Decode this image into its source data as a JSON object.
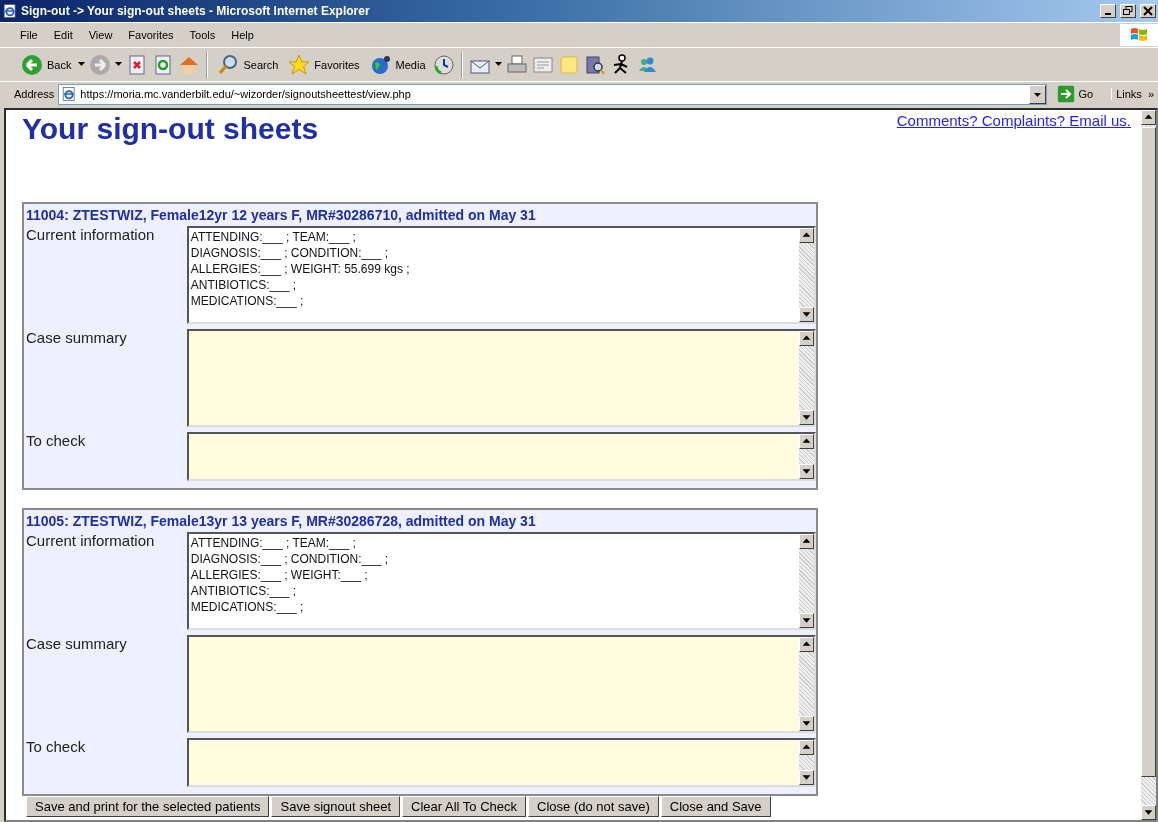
{
  "window": {
    "title": "Sign-out -> Your sign-out sheets - Microsoft Internet Explorer"
  },
  "menu": [
    "File",
    "Edit",
    "View",
    "Favorites",
    "Tools",
    "Help"
  ],
  "toolbar": {
    "back": "Back",
    "search": "Search",
    "favorites": "Favorites",
    "media": "Media"
  },
  "address_bar": {
    "label": "Address",
    "url": "https://moria.mc.vanderbilt.edu/~wizorder/signoutsheettest/view.php",
    "go": "Go",
    "links": "Links",
    "more": "»"
  },
  "page": {
    "heading": "Your sign-out sheets",
    "feedback_link": "Comments? Complaints? Email us.",
    "patients": [
      {
        "header": "11004: ZTESTWIZ, Female12yr 12 years F, MR#30286710, admitted on May 31",
        "fields": [
          {
            "label": "Current information",
            "readonly": true,
            "kind": "large",
            "lines": [
              "ATTENDING:___ ; TEAM:___ ;",
              "DIAGNOSIS:___ ; CONDITION:___ ;",
              "ALLERGIES:___ ; WEIGHT: 55.699 kgs ;",
              "ANTIBIOTICS:___ ;",
              "MEDICATIONS:___ ;"
            ]
          },
          {
            "label": "Case summary",
            "readonly": false,
            "kind": "large"
          },
          {
            "label": "To check",
            "readonly": false,
            "kind": "small"
          }
        ]
      },
      {
        "header": "11005: ZTESTWIZ, Female13yr 13 years F, MR#30286728, admitted on May 31",
        "fields": [
          {
            "label": "Current information",
            "readonly": true,
            "kind": "large",
            "lines": [
              "ATTENDING:___ ; TEAM:___ ;",
              "DIAGNOSIS:___ ; CONDITION:___ ;",
              "ALLERGIES:___ ; WEIGHT:___ ;",
              "ANTIBIOTICS:___ ;",
              "MEDICATIONS:___ ;"
            ]
          },
          {
            "label": "Case summary",
            "readonly": false,
            "kind": "large"
          },
          {
            "label": "To check",
            "readonly": false,
            "kind": "small"
          }
        ]
      }
    ]
  },
  "buttons": [
    "Save and print for the selected patients",
    "Save signout sheet",
    "Clear All To Check",
    "Close (do not save)",
    "Close and Save"
  ]
}
